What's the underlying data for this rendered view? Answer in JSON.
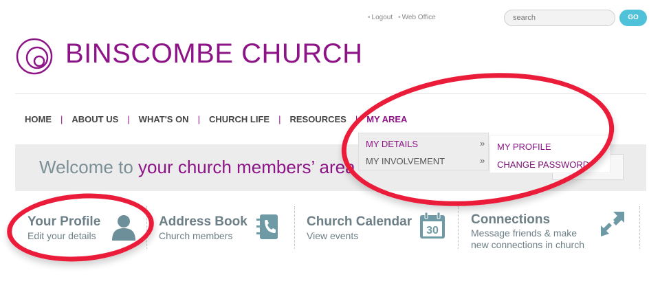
{
  "header": {
    "util_links": [
      "Logout",
      "Web Office"
    ],
    "search_placeholder": "search",
    "go_label": "GO",
    "site_title": "BINSCOMBE CHURCH"
  },
  "nav": {
    "items": [
      "HOME",
      "ABOUT US",
      "WHAT'S ON",
      "CHURCH LIFE",
      "RESOURCES",
      "MY AREA"
    ],
    "active": "MY AREA"
  },
  "welcome": {
    "prefix": "Welcome to",
    "highlight": "your church members’ area"
  },
  "dropdown": {
    "items": [
      {
        "label": "MY DETAILS",
        "arrow": "»"
      },
      {
        "label": "MY INVOLVEMENT",
        "arrow": "»"
      }
    ],
    "submenu": [
      "MY PROFILE",
      "CHANGE PASSWORD"
    ]
  },
  "tiles": [
    {
      "title": "Your Profile",
      "subtitle": "Edit your details",
      "icon": "person-icon"
    },
    {
      "title": "Address Book",
      "subtitle": "Church members",
      "icon": "address-book-icon"
    },
    {
      "title": "Church Calendar",
      "subtitle": "View events",
      "icon": "calendar-icon",
      "icon_text": "30"
    },
    {
      "title": "Connections",
      "subtitle": "Message friends & make new connections in church",
      "subtitle_lines": [
        "Message friends & make",
        "new connections in church"
      ],
      "icon": "connections-arrows-icon"
    }
  ],
  "colors": {
    "brand_purple": "#8d1486",
    "accent_teal": "#4fc1d9",
    "tile_gray": "#6d7f86",
    "annotation_red": "#ea1c3a"
  }
}
